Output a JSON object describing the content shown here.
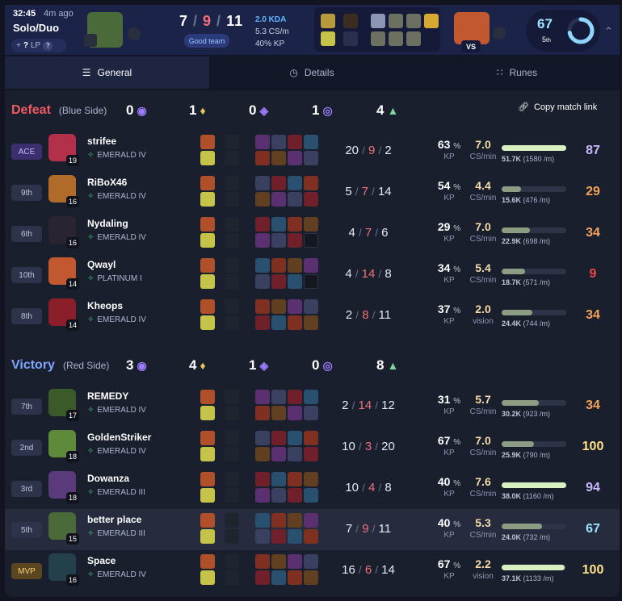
{
  "header": {
    "time": "32:45",
    "ago": "4m ago",
    "queue": "Solo/Duo",
    "lp_label": "LP",
    "lp_help": "?",
    "lp_prefix": "+",
    "lp_value": "?",
    "kda_k": "7",
    "kda_d": "9",
    "kda_a": "11",
    "good_team": "Good team",
    "kda_ratio": "2.0 KDA",
    "cs_min": "5.3 CS/m",
    "kp": "40% KP",
    "vs": "VS",
    "level": "67",
    "place": "5",
    "place_suffix": "th",
    "level_progress": 0.72
  },
  "tabs": [
    {
      "label": "General",
      "icon": "list-icon",
      "active": true
    },
    {
      "label": "Details",
      "icon": "clock-icon",
      "active": false
    },
    {
      "label": "Runes",
      "icon": "grid-icon",
      "active": false
    }
  ],
  "copy_link": "Copy match link",
  "teams": [
    {
      "result": "Defeat",
      "side": "(Blue Side)",
      "color": "#f05a62",
      "objectives": [
        "0",
        "1",
        "0",
        "1",
        "4"
      ],
      "players": [
        {
          "rank": "ACE",
          "rank_type": "ace",
          "name": "strifee",
          "tier": "EMERALD IV",
          "level": "19",
          "k": "20",
          "d": "9",
          "a": "2",
          "kp": "63",
          "cs": "7.0",
          "cs_label": "CS/min",
          "dmg_fill": 1.0,
          "dmg": "51.7K",
          "dmg_per": "(1580 /m)",
          "score": "87",
          "score_color": "#c9b8ff",
          "avatar_color": "#b3304a"
        },
        {
          "rank": "9th",
          "rank_type": "",
          "name": "RiBoX46",
          "tier": "EMERALD IV",
          "level": "16",
          "k": "5",
          "d": "7",
          "a": "14",
          "kp": "54",
          "cs": "4.4",
          "cs_label": "CS/min",
          "dmg_fill": 0.3,
          "dmg": "15.6K",
          "dmg_per": "(476 /m)",
          "score": "29",
          "score_color": "#f5a35b",
          "avatar_color": "#b06a2a"
        },
        {
          "rank": "6th",
          "rank_type": "",
          "name": "Nydaling",
          "tier": "EMERALD IV",
          "level": "16",
          "k": "4",
          "d": "7",
          "a": "6",
          "kp": "29",
          "cs": "7.0",
          "cs_label": "CS/min",
          "dmg_fill": 0.44,
          "dmg": "22.9K",
          "dmg_per": "(698 /m)",
          "score": "34",
          "score_color": "#f5a35b",
          "avatar_color": "#2a2430"
        },
        {
          "rank": "10th",
          "rank_type": "",
          "name": "Qwayl",
          "tier": "PLATINUM I",
          "level": "14",
          "k": "4",
          "d": "14",
          "a": "8",
          "kp": "34",
          "cs": "5.4",
          "cs_label": "CS/min",
          "dmg_fill": 0.36,
          "dmg": "18.7K",
          "dmg_per": "(571 /m)",
          "score": "9",
          "score_color": "#f0444e",
          "avatar_color": "#c1582f"
        },
        {
          "rank": "8th",
          "rank_type": "",
          "name": "Kheops",
          "tier": "EMERALD IV",
          "level": "14",
          "k": "2",
          "d": "8",
          "a": "11",
          "kp": "37",
          "cs": "2.0",
          "cs_label": "vision",
          "dmg_fill": 0.47,
          "dmg": "24.4K",
          "dmg_per": "(744 /m)",
          "score": "34",
          "score_color": "#f5a35b",
          "avatar_color": "#8a1f2a"
        }
      ]
    },
    {
      "result": "Victory",
      "side": "(Red Side)",
      "color": "#7fa6ff",
      "objectives": [
        "3",
        "4",
        "1",
        "0",
        "8"
      ],
      "players": [
        {
          "rank": "7th",
          "rank_type": "",
          "name": "REMEDY",
          "tier": "EMERALD IV",
          "level": "17",
          "k": "2",
          "d": "14",
          "a": "12",
          "kp": "31",
          "cs": "5.7",
          "cs_label": "CS/min",
          "dmg_fill": 0.58,
          "dmg": "30.2K",
          "dmg_per": "(923 /m)",
          "score": "34",
          "score_color": "#f5a35b",
          "avatar_color": "#3a5a2a"
        },
        {
          "rank": "2nd",
          "rank_type": "",
          "name": "GoldenStriker",
          "tier": "EMERALD IV",
          "level": "18",
          "k": "10",
          "d": "3",
          "a": "20",
          "kp": "67",
          "cs": "7.0",
          "cs_label": "CS/min",
          "dmg_fill": 0.5,
          "dmg": "25.9K",
          "dmg_per": "(790 /m)",
          "score": "100",
          "score_color": "#ffe28a",
          "avatar_color": "#5f8a3a"
        },
        {
          "rank": "3rd",
          "rank_type": "",
          "name": "Dowanza",
          "tier": "EMERALD III",
          "level": "18",
          "k": "10",
          "d": "4",
          "a": "8",
          "kp": "40",
          "cs": "7.6",
          "cs_label": "CS/min",
          "dmg_fill": 1.0,
          "dmg": "38.0K",
          "dmg_per": "(1160 /m)",
          "score": "94",
          "score_color": "#c9b8ff",
          "avatar_color": "#5a3a7a"
        },
        {
          "rank": "5th",
          "rank_type": "",
          "name": "better place",
          "tier": "EMERALD III",
          "level": "15",
          "k": "7",
          "d": "9",
          "a": "11",
          "kp": "40",
          "cs": "5.3",
          "cs_label": "CS/min",
          "dmg_fill": 0.62,
          "dmg": "24.0K",
          "dmg_per": "(732 /m)",
          "score": "67",
          "score_color": "#9fe2ff",
          "avatar_color": "#4a6a3a",
          "me": true
        },
        {
          "rank": "MVP",
          "rank_type": "mvp",
          "name": "Space",
          "tier": "EMERALD IV",
          "level": "16",
          "k": "16",
          "d": "6",
          "a": "14",
          "kp": "67",
          "cs": "2.2",
          "cs_label": "vision",
          "dmg_fill": 0.97,
          "dmg": "37.1K",
          "dmg_per": "(1133 /m)",
          "score": "100",
          "score_color": "#ffe28a",
          "avatar_color": "#24404a"
        }
      ]
    }
  ]
}
